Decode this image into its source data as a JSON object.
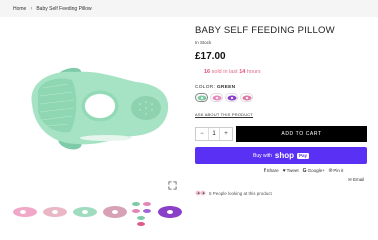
{
  "breadcrumb": {
    "home": "Home",
    "separator": "›",
    "current": "Baby Self Feeding Pillow"
  },
  "product": {
    "title": "BABY SELF FEEDING PILLOW",
    "stock": "In Stock",
    "price": "£17.00",
    "sold_count": "16",
    "sold_middle": "sold in last",
    "sold_hours": "14",
    "sold_suffix": "hours",
    "color_label": "COLOR:",
    "color_value": "GREEN",
    "size_link": "ASK ABOUT THIS PRODUCT",
    "quantity": "1",
    "minus": "−",
    "plus": "+",
    "add_to_cart": "ADD TO CART",
    "buy_with": "Buy with",
    "shop_logo": "shop",
    "pay_logo": "Pay",
    "looking": "5 People looking at this product"
  },
  "share": {
    "facebook": "Share",
    "twitter": "Tweet",
    "google": "Google+",
    "pinterest": "Pin it",
    "email": "Email"
  },
  "swatch_colors": [
    "#7fc9a4",
    "#e88cc0",
    "#8a3fc9",
    "#e07aa8"
  ],
  "selected_color_index": 0,
  "icons": {
    "zoom": "expand-arrows-icon",
    "facebook": "facebook-icon",
    "twitter": "twitter-icon",
    "google": "google-plus-icon",
    "pinterest": "pinterest-icon",
    "email": "email-icon",
    "looking": "eyes-icon"
  }
}
